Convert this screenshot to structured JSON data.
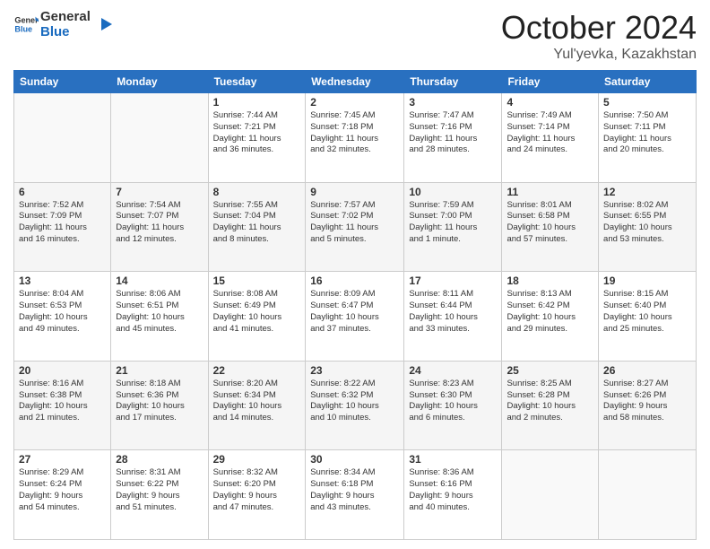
{
  "header": {
    "logo_general": "General",
    "logo_blue": "Blue",
    "month_title": "October 2024",
    "subtitle": "Yul'yevka, Kazakhstan"
  },
  "weekdays": [
    "Sunday",
    "Monday",
    "Tuesday",
    "Wednesday",
    "Thursday",
    "Friday",
    "Saturday"
  ],
  "weeks": [
    [
      {
        "day": "",
        "info": ""
      },
      {
        "day": "",
        "info": ""
      },
      {
        "day": "1",
        "info": "Sunrise: 7:44 AM\nSunset: 7:21 PM\nDaylight: 11 hours\nand 36 minutes."
      },
      {
        "day": "2",
        "info": "Sunrise: 7:45 AM\nSunset: 7:18 PM\nDaylight: 11 hours\nand 32 minutes."
      },
      {
        "day": "3",
        "info": "Sunrise: 7:47 AM\nSunset: 7:16 PM\nDaylight: 11 hours\nand 28 minutes."
      },
      {
        "day": "4",
        "info": "Sunrise: 7:49 AM\nSunset: 7:14 PM\nDaylight: 11 hours\nand 24 minutes."
      },
      {
        "day": "5",
        "info": "Sunrise: 7:50 AM\nSunset: 7:11 PM\nDaylight: 11 hours\nand 20 minutes."
      }
    ],
    [
      {
        "day": "6",
        "info": "Sunrise: 7:52 AM\nSunset: 7:09 PM\nDaylight: 11 hours\nand 16 minutes."
      },
      {
        "day": "7",
        "info": "Sunrise: 7:54 AM\nSunset: 7:07 PM\nDaylight: 11 hours\nand 12 minutes."
      },
      {
        "day": "8",
        "info": "Sunrise: 7:55 AM\nSunset: 7:04 PM\nDaylight: 11 hours\nand 8 minutes."
      },
      {
        "day": "9",
        "info": "Sunrise: 7:57 AM\nSunset: 7:02 PM\nDaylight: 11 hours\nand 5 minutes."
      },
      {
        "day": "10",
        "info": "Sunrise: 7:59 AM\nSunset: 7:00 PM\nDaylight: 11 hours\nand 1 minute."
      },
      {
        "day": "11",
        "info": "Sunrise: 8:01 AM\nSunset: 6:58 PM\nDaylight: 10 hours\nand 57 minutes."
      },
      {
        "day": "12",
        "info": "Sunrise: 8:02 AM\nSunset: 6:55 PM\nDaylight: 10 hours\nand 53 minutes."
      }
    ],
    [
      {
        "day": "13",
        "info": "Sunrise: 8:04 AM\nSunset: 6:53 PM\nDaylight: 10 hours\nand 49 minutes."
      },
      {
        "day": "14",
        "info": "Sunrise: 8:06 AM\nSunset: 6:51 PM\nDaylight: 10 hours\nand 45 minutes."
      },
      {
        "day": "15",
        "info": "Sunrise: 8:08 AM\nSunset: 6:49 PM\nDaylight: 10 hours\nand 41 minutes."
      },
      {
        "day": "16",
        "info": "Sunrise: 8:09 AM\nSunset: 6:47 PM\nDaylight: 10 hours\nand 37 minutes."
      },
      {
        "day": "17",
        "info": "Sunrise: 8:11 AM\nSunset: 6:44 PM\nDaylight: 10 hours\nand 33 minutes."
      },
      {
        "day": "18",
        "info": "Sunrise: 8:13 AM\nSunset: 6:42 PM\nDaylight: 10 hours\nand 29 minutes."
      },
      {
        "day": "19",
        "info": "Sunrise: 8:15 AM\nSunset: 6:40 PM\nDaylight: 10 hours\nand 25 minutes."
      }
    ],
    [
      {
        "day": "20",
        "info": "Sunrise: 8:16 AM\nSunset: 6:38 PM\nDaylight: 10 hours\nand 21 minutes."
      },
      {
        "day": "21",
        "info": "Sunrise: 8:18 AM\nSunset: 6:36 PM\nDaylight: 10 hours\nand 17 minutes."
      },
      {
        "day": "22",
        "info": "Sunrise: 8:20 AM\nSunset: 6:34 PM\nDaylight: 10 hours\nand 14 minutes."
      },
      {
        "day": "23",
        "info": "Sunrise: 8:22 AM\nSunset: 6:32 PM\nDaylight: 10 hours\nand 10 minutes."
      },
      {
        "day": "24",
        "info": "Sunrise: 8:23 AM\nSunset: 6:30 PM\nDaylight: 10 hours\nand 6 minutes."
      },
      {
        "day": "25",
        "info": "Sunrise: 8:25 AM\nSunset: 6:28 PM\nDaylight: 10 hours\nand 2 minutes."
      },
      {
        "day": "26",
        "info": "Sunrise: 8:27 AM\nSunset: 6:26 PM\nDaylight: 9 hours\nand 58 minutes."
      }
    ],
    [
      {
        "day": "27",
        "info": "Sunrise: 8:29 AM\nSunset: 6:24 PM\nDaylight: 9 hours\nand 54 minutes."
      },
      {
        "day": "28",
        "info": "Sunrise: 8:31 AM\nSunset: 6:22 PM\nDaylight: 9 hours\nand 51 minutes."
      },
      {
        "day": "29",
        "info": "Sunrise: 8:32 AM\nSunset: 6:20 PM\nDaylight: 9 hours\nand 47 minutes."
      },
      {
        "day": "30",
        "info": "Sunrise: 8:34 AM\nSunset: 6:18 PM\nDaylight: 9 hours\nand 43 minutes."
      },
      {
        "day": "31",
        "info": "Sunrise: 8:36 AM\nSunset: 6:16 PM\nDaylight: 9 hours\nand 40 minutes."
      },
      {
        "day": "",
        "info": ""
      },
      {
        "day": "",
        "info": ""
      }
    ]
  ]
}
